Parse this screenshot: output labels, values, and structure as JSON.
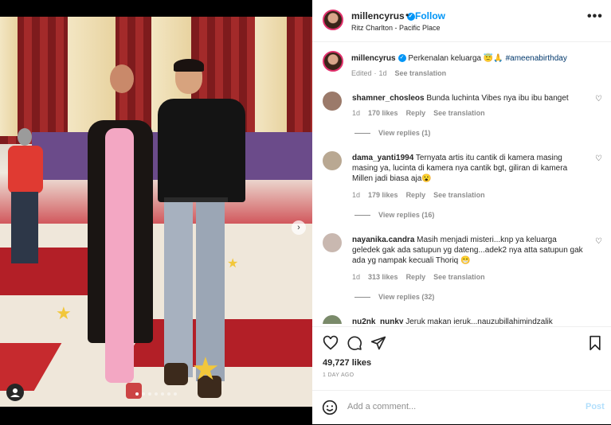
{
  "post": {
    "username": "millencyrus",
    "follow_label": "Follow",
    "location": "Ritz Charlton - Pacific Place",
    "more_label": "•••"
  },
  "caption": {
    "username": "millencyrus",
    "text": "Perkenalan keluarga 😇🙏",
    "hashtag": "#ameenabirthday",
    "edited": "Edited",
    "age": "1d",
    "see_translation": "See translation"
  },
  "comments": [
    {
      "username": "shamner_chosleos",
      "text": "Bunda luchinta Vibes nya ibu ibu banget",
      "age": "1d",
      "likes": "170 likes",
      "reply": "Reply",
      "see_translation": "See translation",
      "view_replies": "View replies (1)",
      "avatar_color": "#9b7a6a"
    },
    {
      "username": "dama_yanti1994",
      "text": "Ternyata artis itu cantik di kamera masing masing ya, lucinta di kamera nya cantik bgt, giliran di kamera Millen jadi biasa aja😮",
      "age": "1d",
      "likes": "179 likes",
      "reply": "Reply",
      "see_translation": "See translation",
      "view_replies": "View replies (16)",
      "avatar_color": "#b9a892"
    },
    {
      "username": "nayanika.candra",
      "text": "Masih menjadi misteri...knp ya keluarga geledek gak ada satupun yg dateng...adek2 nya atta satupun gak ada yg nampak kecuali Thoriq 😁",
      "age": "1d",
      "likes": "313 likes",
      "reply": "Reply",
      "see_translation": "See translation",
      "view_replies": "View replies (32)",
      "avatar_color": "#c9b8b0"
    },
    {
      "username": "nu2nk_nunky",
      "text": "Jeruk makan jeruk...nauzubillahimindzalik",
      "avatar_color": "#7a8a6a"
    }
  ],
  "likes_count": "49,727 likes",
  "post_date": "1 DAY AGO",
  "add_comment": {
    "placeholder": "Add a comment...",
    "post_label": "Post"
  },
  "colors": {
    "accent": "#0095f6",
    "link": "#00376b",
    "muted": "#8e8e8e"
  },
  "icons": [
    "heart-icon",
    "comment-icon",
    "share-icon",
    "bookmark-icon",
    "emoji-icon",
    "verified-icon",
    "tag-user-icon",
    "chevron-right-icon",
    "more-icon"
  ]
}
